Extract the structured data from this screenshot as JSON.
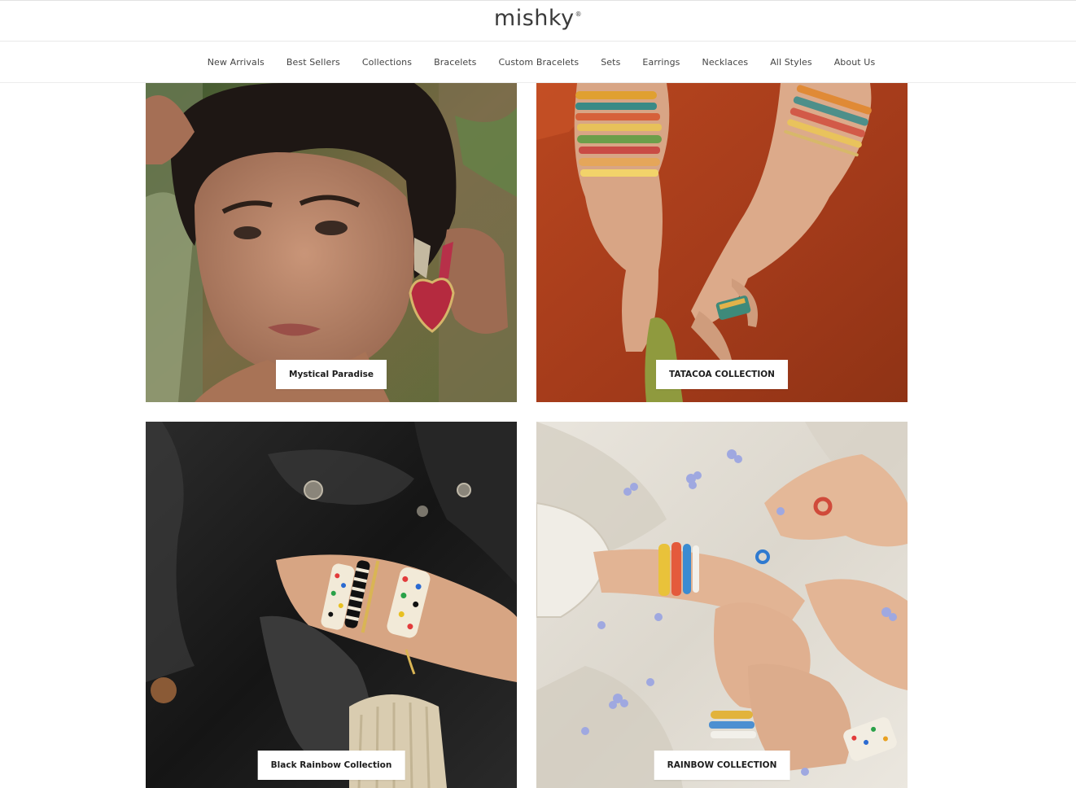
{
  "header": {
    "logo_text": "mishky",
    "logo_mark": "®"
  },
  "nav": {
    "items": [
      {
        "label": "New Arrivals"
      },
      {
        "label": "Best Sellers"
      },
      {
        "label": "Collections"
      },
      {
        "label": "Bracelets"
      },
      {
        "label": "Custom Bracelets"
      },
      {
        "label": "Sets"
      },
      {
        "label": "Earrings"
      },
      {
        "label": "Necklaces"
      },
      {
        "label": "All Styles"
      },
      {
        "label": "About Us"
      }
    ]
  },
  "collections": [
    {
      "label": "Mystical Paradise"
    },
    {
      "label": "TATACOA COLLECTION"
    },
    {
      "label": "Black Rainbow Collection"
    },
    {
      "label": "RAINBOW COLLECTION"
    }
  ],
  "colors": {
    "text_dark": "#1d1d1d",
    "nav_text": "#444444",
    "border": "#e9e9e9",
    "background": "#ffffff"
  }
}
